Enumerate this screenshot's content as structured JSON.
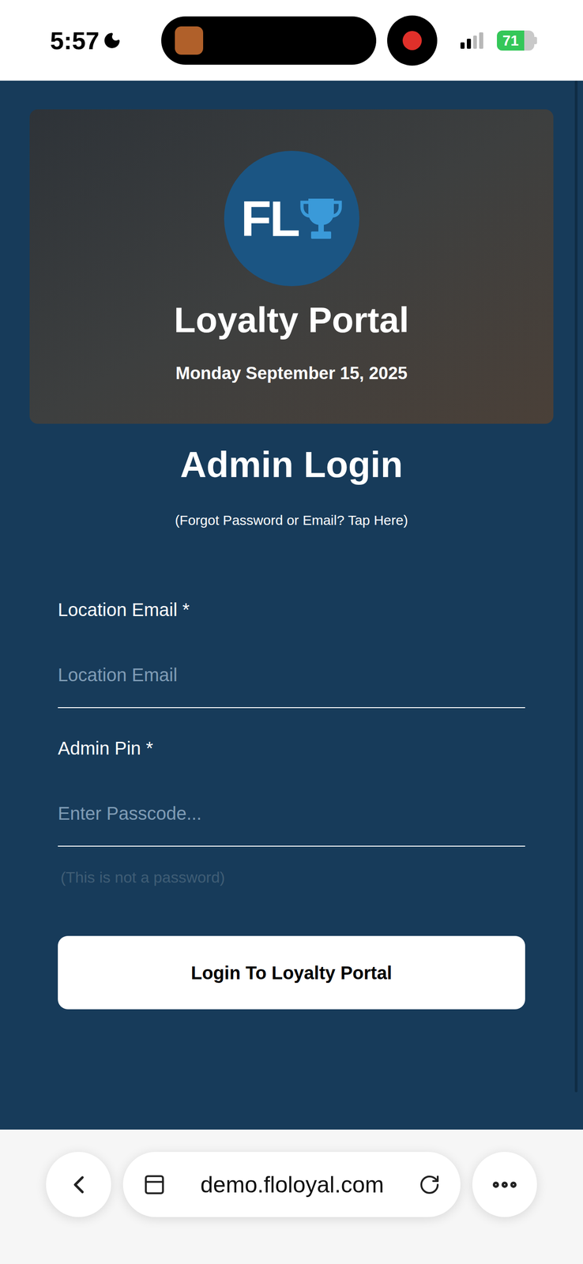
{
  "status_bar": {
    "time": "5:57",
    "battery": "71"
  },
  "hero": {
    "logo_text": "FL",
    "title": "Loyalty Portal",
    "date": "Monday September 15, 2025"
  },
  "login": {
    "heading": "Admin Login",
    "forgot_link": "(Forgot Password or Email? Tap Here)",
    "fields": [
      {
        "label": "Location Email *",
        "placeholder": "Location Email",
        "hint": ""
      },
      {
        "label": "Admin Pin *",
        "placeholder": "Enter Passcode...",
        "hint": "(This is not a password)"
      }
    ],
    "button": "Login To Loyalty Portal"
  },
  "browser": {
    "url": "demo.floloyal.com"
  }
}
